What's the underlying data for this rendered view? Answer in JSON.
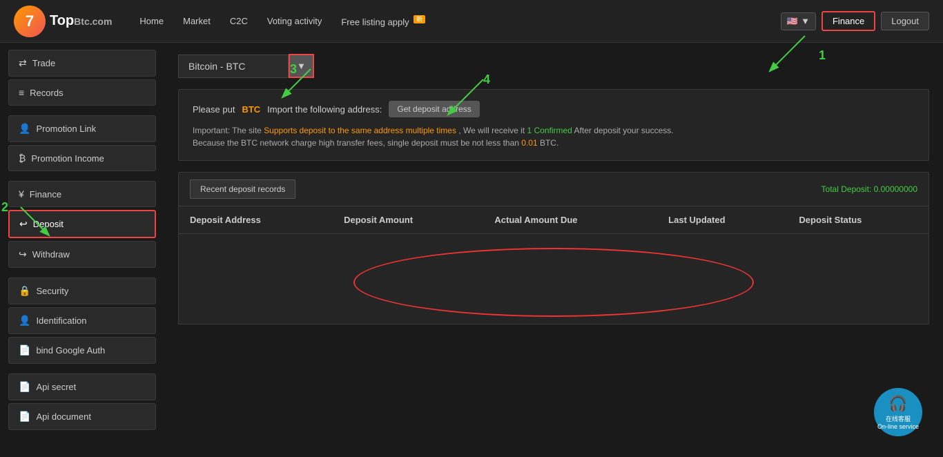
{
  "header": {
    "logo_number": "7",
    "logo_name": "TopBtc",
    "logo_suffix": ".com",
    "nav": [
      {
        "label": "Home",
        "badge": null
      },
      {
        "label": "Market",
        "badge": null
      },
      {
        "label": "C2C",
        "badge": null
      },
      {
        "label": "Voting activity",
        "badge": null
      },
      {
        "label": "Free listing apply",
        "badge": "新"
      }
    ],
    "flag": "🇺🇸",
    "finance_btn": "Finance",
    "logout_btn": "Logout"
  },
  "sidebar": {
    "groups": [
      {
        "items": [
          {
            "icon": "⇄",
            "label": "Trade"
          },
          {
            "icon": "≡",
            "label": "Records"
          }
        ]
      },
      {
        "items": [
          {
            "icon": "👤",
            "label": "Promotion Link"
          },
          {
            "icon": "₿",
            "label": "Promotion Income"
          }
        ]
      },
      {
        "items": [
          {
            "icon": "¥",
            "label": "Finance"
          },
          {
            "icon": "↩",
            "label": "Deposit",
            "active": true
          },
          {
            "icon": "↪",
            "label": "Withdraw"
          }
        ]
      },
      {
        "items": [
          {
            "icon": "🔒",
            "label": "Security"
          },
          {
            "icon": "👤",
            "label": "Identification"
          },
          {
            "icon": "📄",
            "label": "bind Google Auth"
          }
        ]
      },
      {
        "items": [
          {
            "icon": "📄",
            "label": "Api secret"
          },
          {
            "icon": "📄",
            "label": "Api document"
          }
        ]
      }
    ]
  },
  "content": {
    "coin_selector": {
      "value": "Bitcoin - BTC",
      "arrow": "▼"
    },
    "deposit_info": {
      "line1_prefix": "Please put ",
      "line1_btc": "BTC",
      "line1_suffix": " Import the following address:",
      "get_deposit_btn": "Get deposit address",
      "line2_prefix": "Important: The site ",
      "line2_highlight1": "Supports deposit to the same address multiple times",
      "line2_mid": ", We will receive it ",
      "line2_highlight2": "1 Confirmed",
      "line2_mid2": " After deposit your success.",
      "line2_line3": "Because the BTC network charge high transfer fees, single deposit must be not less than ",
      "line2_highlight3": "0.01",
      "line2_end": " BTC."
    },
    "records": {
      "tab_label": "Recent deposit records",
      "total_label": "Total Deposit: ",
      "total_value": "0.00000000",
      "columns": [
        "Deposit Address",
        "Deposit Amount",
        "Actual Amount Due",
        "Last Updated",
        "Deposit Status"
      ],
      "rows": []
    }
  },
  "annotations": {
    "label_1": "1",
    "label_2": "2",
    "label_3": "3",
    "label_4": "4"
  },
  "online_service": {
    "icon": "🎧",
    "line1": "在线客服",
    "line2": "On-line service"
  }
}
